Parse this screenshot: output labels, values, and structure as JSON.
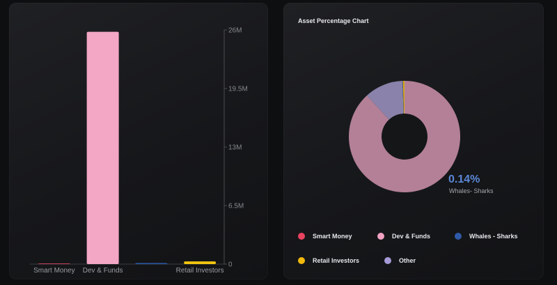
{
  "bar_panel": {
    "chart_data": {
      "type": "bar",
      "categories": [
        "Smart Money",
        "Dev & Funds",
        "",
        "Retail Investors"
      ],
      "values": [
        0,
        25800000,
        60000,
        300000
      ],
      "bar_colors": [
        "#ff4f6a",
        "#f3a7c4",
        "#2a5aa8",
        "#f1c40f"
      ],
      "ylim": [
        0,
        26000000
      ],
      "y_ticks": [
        {
          "value": 0,
          "label": "0"
        },
        {
          "value": 6500000,
          "label": "6.5M"
        },
        {
          "value": 13000000,
          "label": "13M"
        },
        {
          "value": 19500000,
          "label": "19.5M"
        },
        {
          "value": 26000000,
          "label": "26M"
        }
      ],
      "y_axis_position": "right",
      "grid": false
    }
  },
  "donut_panel": {
    "title": "Asset Percentage Chart",
    "highlight": {
      "percent_label": "0.14%",
      "name": "Whales- Sharks"
    },
    "chart_data": {
      "type": "pie",
      "donut": true,
      "slices": [
        {
          "name": "Dev & Funds",
          "value": 88.2,
          "color": "#b38097"
        },
        {
          "name": "Other",
          "value": 11.2,
          "color": "#8a82aa"
        },
        {
          "name": "Whales - Sharks",
          "value": 0.14,
          "color": "#3a5a9a"
        },
        {
          "name": "Retail Investors",
          "value": 0.46,
          "color": "#d8a91a"
        }
      ]
    },
    "legend": [
      {
        "label": "Smart Money",
        "color": "#e8435f"
      },
      {
        "label": "Dev & Funds",
        "color": "#f2a2c0"
      },
      {
        "label": "Whales - Sharks",
        "color": "#2f5aa8"
      },
      {
        "label": "Retail Investors",
        "color": "#f0b90b"
      },
      {
        "label": "Other",
        "color": "#a59ad6"
      }
    ]
  }
}
